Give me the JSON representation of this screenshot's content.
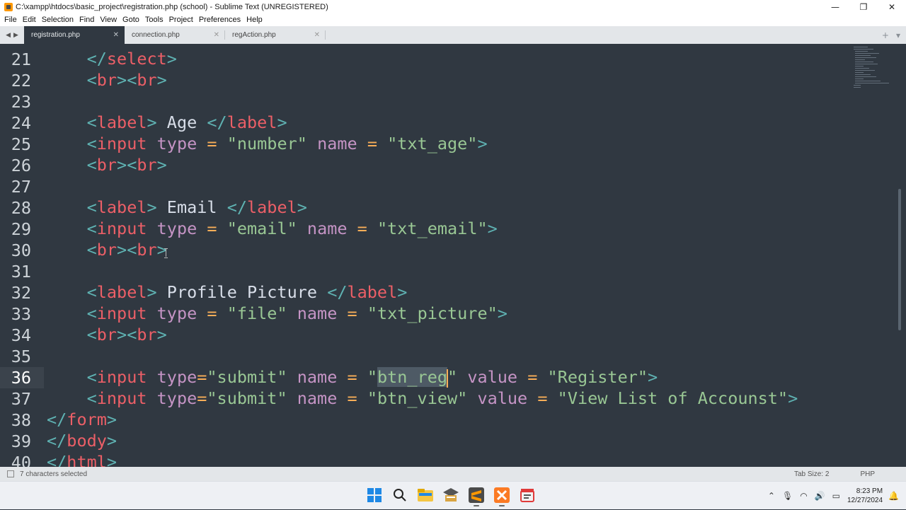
{
  "window": {
    "title": "C:\\xampp\\htdocs\\basic_project\\registration.php (school) - Sublime Text (UNREGISTERED)",
    "controls": [
      "minimize",
      "maximize",
      "close"
    ]
  },
  "menu": [
    "File",
    "Edit",
    "Selection",
    "Find",
    "View",
    "Goto",
    "Tools",
    "Project",
    "Preferences",
    "Help"
  ],
  "tabs": [
    {
      "label": "registration.php",
      "active": true
    },
    {
      "label": "connection.php",
      "active": false
    },
    {
      "label": "regAction.php",
      "active": false
    }
  ],
  "editor": {
    "current_line": "36",
    "line_numbers": [
      "21",
      "22",
      "23",
      "24",
      "25",
      "26",
      "27",
      "28",
      "29",
      "30",
      "31",
      "32",
      "33",
      "34",
      "35",
      "36",
      "37",
      "38",
      "39",
      "40"
    ],
    "selection_text": "btn_reg"
  },
  "status": {
    "left": "7 characters selected",
    "tab_size": "Tab Size: 2",
    "syntax": "PHP"
  },
  "taskbar": {
    "time": "8:23 PM",
    "date": "12/27/2024",
    "apps": [
      "windows-start-icon",
      "search-icon",
      "file-explorer-icon",
      "learning-app-icon",
      "sublime-text-icon",
      "xampp-icon",
      "media-app-icon"
    ]
  },
  "colors": {
    "background": "#303841",
    "tag": "#ec5f67",
    "punct": "#5fb3b3",
    "attr": "#c594c5",
    "string": "#99c794",
    "operator": "#f9ae58",
    "text": "#d8dee9"
  }
}
